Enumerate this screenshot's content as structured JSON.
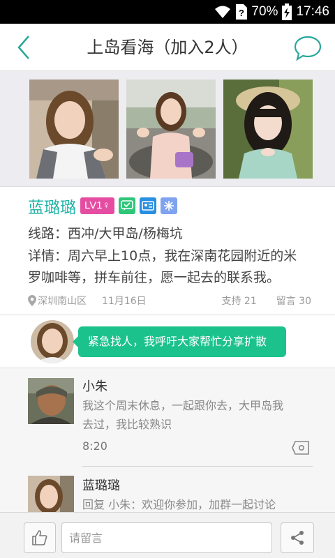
{
  "status_bar": {
    "battery": "70%",
    "time": "17:46",
    "icons": [
      "wifi-icon",
      "sim-unknown-icon",
      "battery-charging-icon"
    ]
  },
  "header": {
    "title": "上岛看海（加入2人）",
    "back_icon": "chevron-left-icon",
    "chat_icon": "chat-bubble-icon"
  },
  "photos": [
    "photo-1",
    "photo-2",
    "photo-3"
  ],
  "post": {
    "author": "蓝璐璐",
    "level": "LV1♀",
    "badge_icons": [
      "verified-chat-icon",
      "id-card-icon",
      "snowflake-icon"
    ],
    "route_label": "线路：",
    "route": "西冲/大甲岛/杨梅坑",
    "detail_label": "详情：",
    "detail_line1": "周六早上10点，我在深南花园附近的米",
    "detail_line2": "罗咖啡等，拼车前往，愿一起去的联系我。",
    "location": "深圳南山区",
    "date": "11月16日",
    "support": "支持 21",
    "comments_count": "留言 30"
  },
  "urgent": {
    "text": "紧急找人，我呼吁大家帮忙分享扩散"
  },
  "comments": [
    {
      "name": "小朱",
      "text_line1": "我这个周末休息，一起跟你去，大甲岛我",
      "text_line2": "去过，我比较熟识",
      "time": "8:20"
    },
    {
      "name": "蓝璐璐",
      "text": "回复 小朱：欢迎你参加，加群一起讨论"
    }
  ],
  "bottom_bar": {
    "input_placeholder": "请留言",
    "like_icon": "thumbs-up-icon",
    "share_icon": "share-icon"
  },
  "colors": {
    "accent": "#21b3a8",
    "bubble": "#1cc28c",
    "level_badge": "#e44da1"
  }
}
